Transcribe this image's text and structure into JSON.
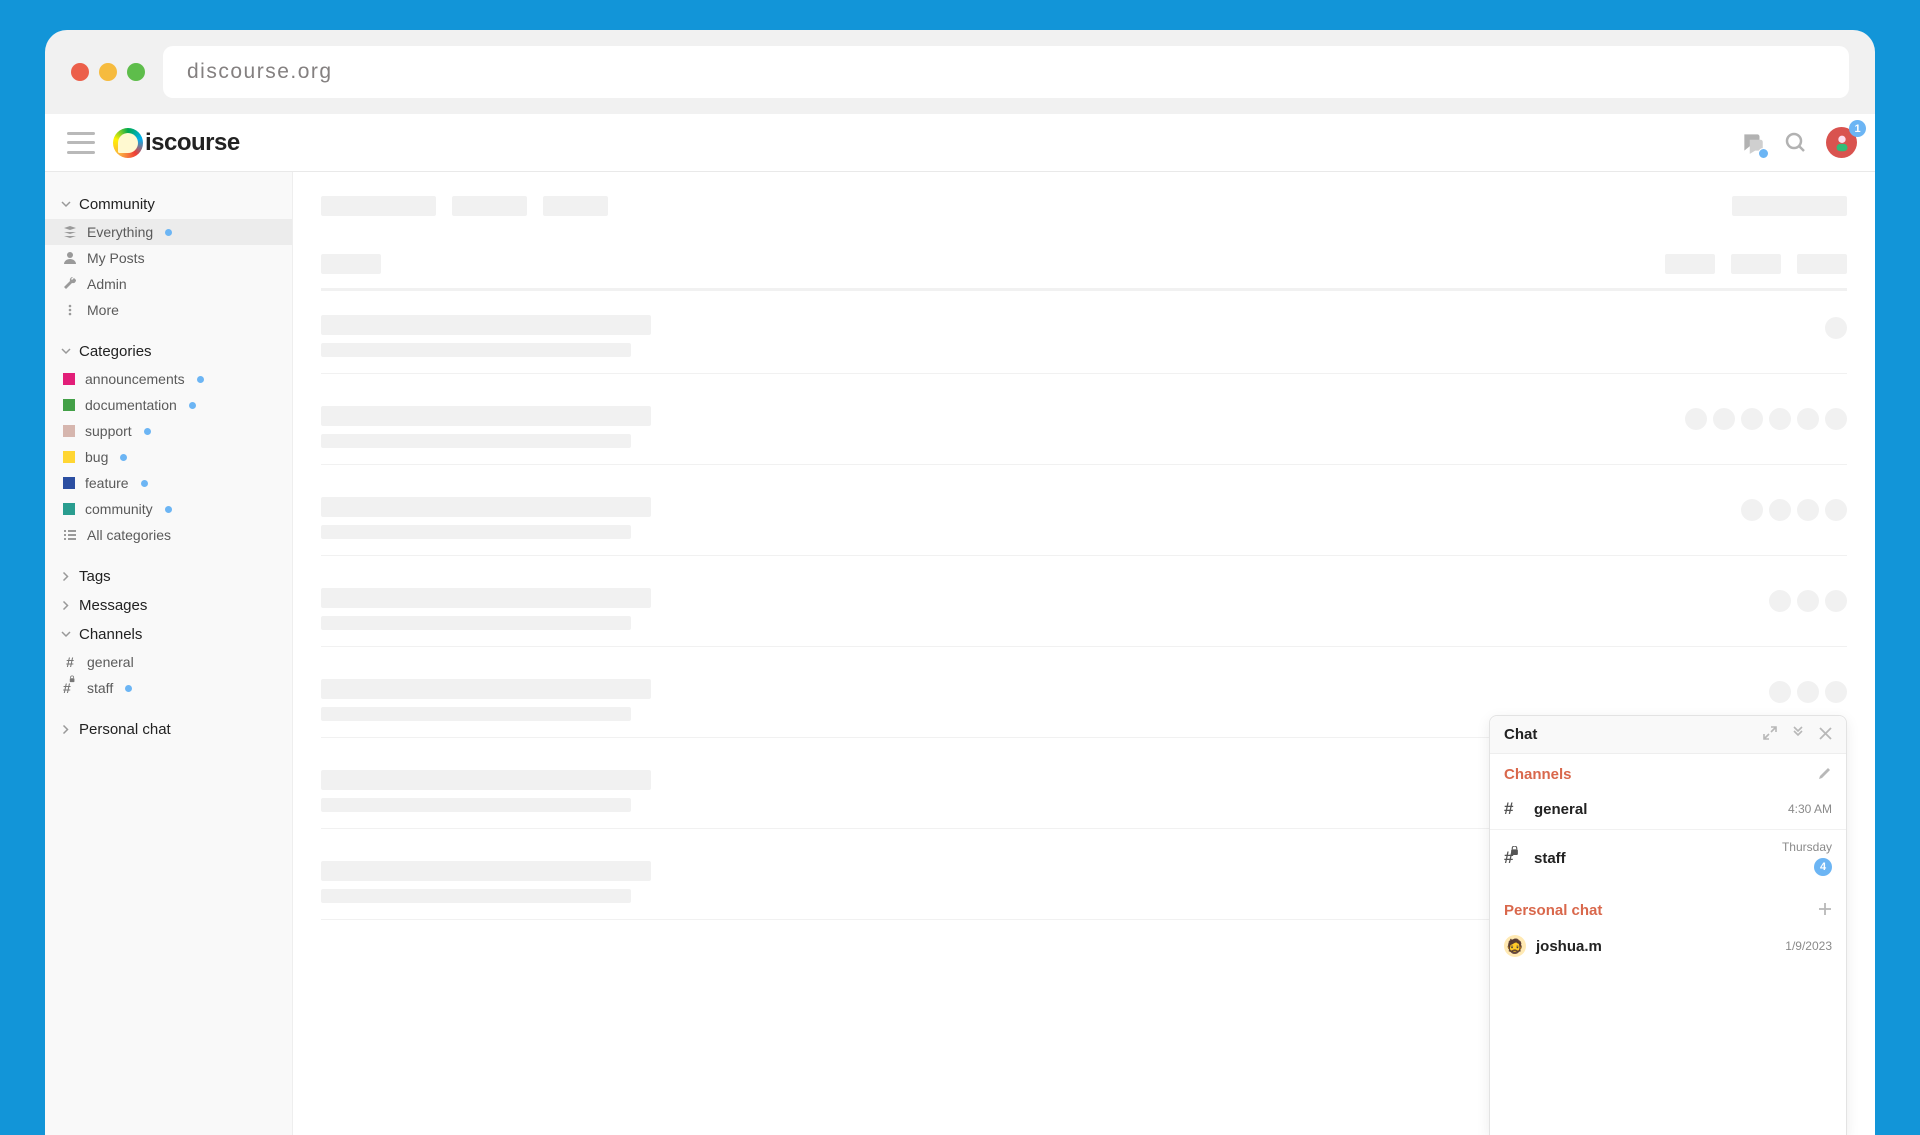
{
  "browser": {
    "url": "discourse.org"
  },
  "header": {
    "brand_text": "iscourse",
    "notification_count": "1"
  },
  "sidebar": {
    "community": {
      "header": "Community",
      "everything": "Everything",
      "my_posts": "My Posts",
      "admin": "Admin",
      "more": "More"
    },
    "categories": {
      "header": "Categories",
      "items": [
        {
          "label": "announcements",
          "color": "#e21e78"
        },
        {
          "label": "documentation",
          "color": "#43a047"
        },
        {
          "label": "support",
          "color": "#d6b6ae"
        },
        {
          "label": "bug",
          "color": "#ffd633"
        },
        {
          "label": "feature",
          "color": "#2b4ea1"
        },
        {
          "label": "community",
          "color": "#2a9d8f"
        }
      ],
      "all": "All categories"
    },
    "tags": {
      "header": "Tags"
    },
    "messages": {
      "header": "Messages"
    },
    "channels": {
      "header": "Channels",
      "items": [
        {
          "label": "general",
          "locked": false
        },
        {
          "label": "staff",
          "locked": true
        }
      ]
    },
    "personal_chat": {
      "header": "Personal chat"
    }
  },
  "chat_drawer": {
    "title": "Chat",
    "channels_label": "Channels",
    "personal_label": "Personal chat",
    "channels": [
      {
        "name": "general",
        "time": "4:30 AM",
        "locked": false,
        "unread": ""
      },
      {
        "name": "staff",
        "time": "Thursday",
        "locked": true,
        "unread": "4"
      }
    ],
    "personal": [
      {
        "name": "joshua.m",
        "time": "1/9/2023"
      }
    ]
  }
}
